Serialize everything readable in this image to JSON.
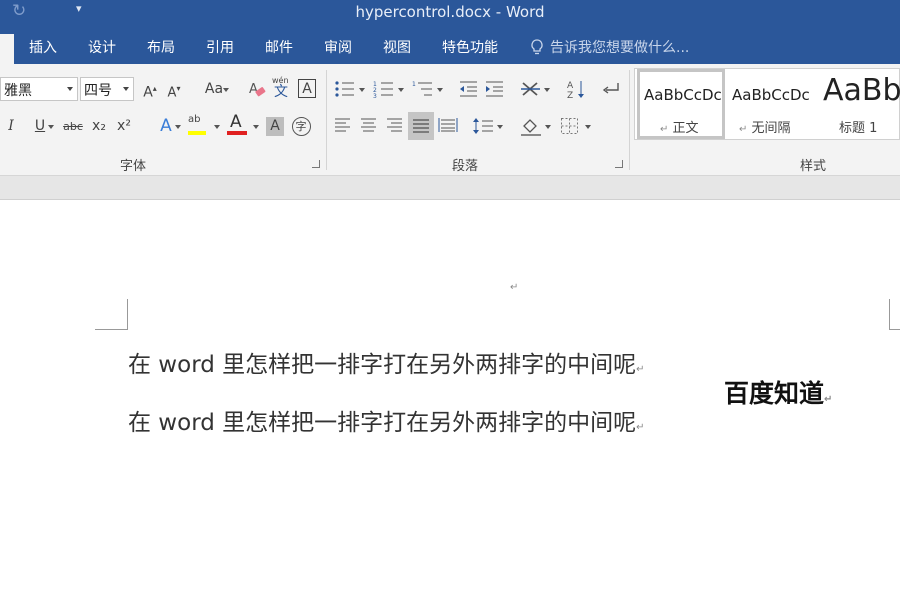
{
  "window": {
    "title": "hypercontrol.docx - Word",
    "qat_more_glyph": "▾"
  },
  "tabs": [
    {
      "label": "插入"
    },
    {
      "label": "设计"
    },
    {
      "label": "布局"
    },
    {
      "label": "引用"
    },
    {
      "label": "邮件"
    },
    {
      "label": "审阅"
    },
    {
      "label": "视图"
    },
    {
      "label": "特色功能"
    }
  ],
  "tell_me": {
    "placeholder": "告诉我您想要做什么..."
  },
  "font_group": {
    "label": "字体",
    "font_name": "雅黑",
    "font_size": "四号",
    "grow_font": "A",
    "shrink_font": "A",
    "change_case": "Aa",
    "phonetic_top": "wén",
    "phonetic_bottom": "文",
    "char_border": "A",
    "italic": "I",
    "underline": "U",
    "strike": "abc",
    "subscript": "x₂",
    "superscript": "x²",
    "text_effects": "A",
    "highlight": "ab",
    "font_color": "A",
    "shading": "A",
    "enclose": "字",
    "font_color_value": "#e02020",
    "highlight_value": "#ffff00"
  },
  "paragraph_group": {
    "label": "段落"
  },
  "styles_group": {
    "label": "样式",
    "items": [
      {
        "sample": "AaBbCcDc",
        "name": "正文",
        "selected": true
      },
      {
        "sample": "AaBbCcDc",
        "name": "无间隔",
        "selected": false
      },
      {
        "sample": "AaBb",
        "name": "标题 1",
        "selected": false
      }
    ]
  },
  "document": {
    "paragraph_mark": "↵",
    "lines": [
      "在 word 里怎样把一排字打在另外两排字的中间呢",
      "在 word 里怎样把一排字打在另外两排字的中间呢"
    ],
    "side_text": "百度知道"
  },
  "theme": {
    "accent": "#2b579a",
    "ribbon_bg": "#f3f3f3"
  }
}
